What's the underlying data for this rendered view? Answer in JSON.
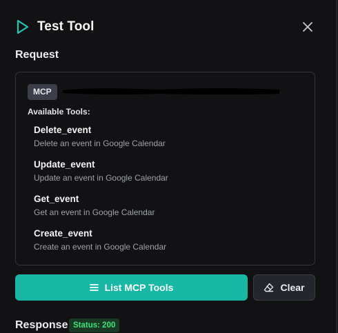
{
  "header": {
    "title": "Test Tool",
    "play_icon": "play-icon",
    "close_icon": "close-icon"
  },
  "request": {
    "section_label": "Request",
    "badge": "MCP",
    "available_label": "Available Tools:",
    "tools": [
      {
        "name": "Delete_event",
        "description": "Delete an event in Google Calendar"
      },
      {
        "name": "Update_event",
        "description": "Update an event in Google Calendar"
      },
      {
        "name": "Get_event",
        "description": "Get an event in Google Calendar"
      },
      {
        "name": "Create_event",
        "description": "Create an event in Google Calendar"
      }
    ]
  },
  "actions": {
    "list_label": "List MCP Tools",
    "list_icon": "list-icon",
    "clear_label": "Clear",
    "clear_icon": "eraser-icon"
  },
  "response": {
    "section_label": "Response",
    "status": "Status: 200"
  },
  "colors": {
    "accent": "#18b8a4",
    "status_green": "#3ee07a",
    "background": "#121214"
  }
}
